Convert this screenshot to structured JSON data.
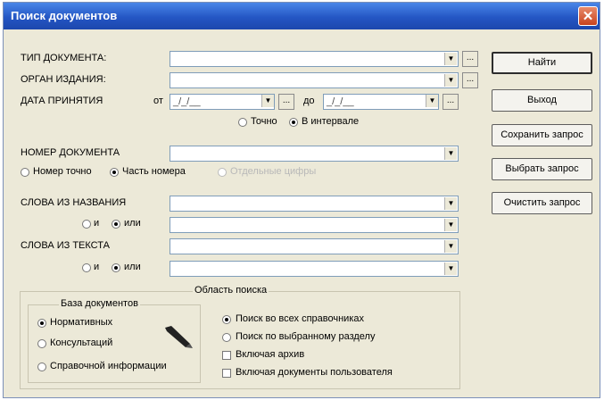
{
  "window": {
    "title": "Поиск документов",
    "close_glyph": "✕"
  },
  "fields": {
    "doc_type": {
      "label": "ТИП ДОКУМЕНТА:",
      "value": ""
    },
    "issuer": {
      "label": "ОРГАН ИЗДАНИЯ:",
      "value": ""
    },
    "date": {
      "label": "ДАТА ПРИНЯТИЯ",
      "from_label": "от",
      "to_label": "до",
      "from_value": "_/_/__",
      "to_value": "_/_/__"
    },
    "date_mode": {
      "exact": "Точно",
      "interval": "В интервале",
      "selected": "interval"
    },
    "doc_number": {
      "label": "НОМЕР ДОКУМЕНТА",
      "value": ""
    },
    "number_mode": {
      "exact": "Номер точно",
      "part": "Часть номера",
      "digits": "Отдельные цифры",
      "selected": "part"
    },
    "title_words": {
      "label": "СЛОВА ИЗ НАЗВАНИЯ",
      "and": "и",
      "or": "или",
      "selected": "or"
    },
    "text_words": {
      "label": "СЛОВА ИЗ ТЕКСТА",
      "and": "и",
      "or": "или",
      "selected": "or"
    }
  },
  "buttons": {
    "find": "Найти",
    "exit": "Выход",
    "save_query": "Сохранить запрос",
    "select_query": "Выбрать запрос",
    "clear_query": "Очистить запрос"
  },
  "dots_glyph": "...",
  "arrow_glyph": "▼",
  "search_area": {
    "title": "Область поиска",
    "base": {
      "title": "База документов",
      "options": [
        "Нормативных",
        "Консультаций",
        "Справочной информации"
      ],
      "selected": 0
    },
    "scope": {
      "all": "Поиск во всех справочниках",
      "section": "Поиск по выбранному разделу",
      "selected": "all"
    },
    "include_archive": {
      "label": "Включая архив",
      "checked": false
    },
    "include_user_docs": {
      "label": "Включая документы пользователя",
      "checked": false
    }
  },
  "colors": {
    "titlebar": "#2456c4",
    "window_bg": "#ece9d8",
    "close": "#c8431f"
  }
}
